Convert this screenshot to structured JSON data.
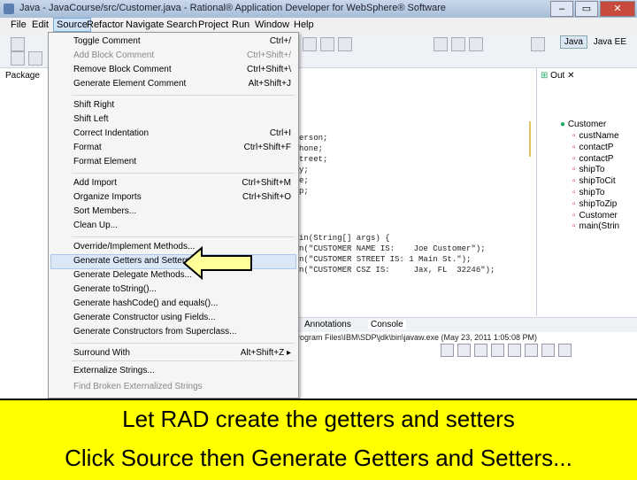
{
  "window": {
    "title": "Java - JavaCourse/src/Customer.java - Rational® Application Developer for WebSphere® Software"
  },
  "menubar": [
    "File",
    "Edit",
    "Source",
    "Refactor",
    "Navigate",
    "Search",
    "Project",
    "Run",
    "Window",
    "Help"
  ],
  "perspective": {
    "java": "Java",
    "java_ee": "Java EE"
  },
  "left_tab": "Package",
  "source_menu": [
    {
      "label": "Toggle Comment",
      "shortcut": "Ctrl+/",
      "disabled": false
    },
    {
      "label": "Add Block Comment",
      "shortcut": "Ctrl+Shift+/",
      "disabled": true
    },
    {
      "label": "Remove Block Comment",
      "shortcut": "Ctrl+Shift+\\",
      "disabled": false
    },
    {
      "label": "Generate Element Comment",
      "shortcut": "Alt+Shift+J",
      "disabled": false
    },
    {
      "label": "Shift Right",
      "shortcut": "",
      "disabled": false
    },
    {
      "label": "Shift Left",
      "shortcut": "",
      "disabled": false
    },
    {
      "label": "Correct Indentation",
      "shortcut": "Ctrl+I",
      "disabled": false
    },
    {
      "label": "Format",
      "shortcut": "Ctrl+Shift+F",
      "disabled": false
    },
    {
      "label": "Format Element",
      "shortcut": "",
      "disabled": false
    },
    {
      "label": "Add Import",
      "shortcut": "Ctrl+Shift+M",
      "disabled": false
    },
    {
      "label": "Organize Imports",
      "shortcut": "Ctrl+Shift+O",
      "disabled": false
    },
    {
      "label": "Sort Members...",
      "shortcut": "",
      "disabled": false
    },
    {
      "label": "Clean Up...",
      "shortcut": "",
      "disabled": false
    },
    {
      "label": "Override/Implement Methods...",
      "shortcut": "",
      "disabled": false
    },
    {
      "label": "Generate Getters and Setters...",
      "shortcut": "",
      "disabled": false
    },
    {
      "label": "Generate Delegate Methods...",
      "shortcut": "",
      "disabled": false
    },
    {
      "label": "Generate toString()...",
      "shortcut": "",
      "disabled": false
    },
    {
      "label": "Generate hashCode() and equals()...",
      "shortcut": "",
      "disabled": false
    },
    {
      "label": "Generate Constructor using Fields...",
      "shortcut": "",
      "disabled": false
    },
    {
      "label": "Generate Constructors from Superclass...",
      "shortcut": "",
      "disabled": false
    },
    {
      "label": "Surround With",
      "shortcut": "Alt+Shift+Z ▸",
      "disabled": false
    },
    {
      "label": "Externalize Strings...",
      "shortcut": "",
      "disabled": false
    },
    {
      "label": "Find Broken Externalized Strings",
      "shortcut": "",
      "disabled": true
    }
  ],
  "code_lines": [
    "erson;",
    "hone;",
    "treet;",
    "y;",
    "e;",
    "p;",
    "in(String[] args) {",
    "n(\"CUSTOMER NAME IS:    Joe Customer\");",
    "n(\"CUSTOMER STREET IS: 1 Main St.\");",
    "n(\"CUSTOMER CSZ IS:     Jax, FL  32246\");"
  ],
  "outline": {
    "tab": "Out",
    "root": "Customer",
    "items": [
      "custName",
      "contactP",
      "contactP",
      "shipTo",
      "shipToCit",
      "shipTo",
      "shipToZip",
      "Customer",
      "main(Strin"
    ]
  },
  "bottom_tabs": {
    "annotations": "Annotations",
    "console": "Console"
  },
  "console_line": "rogram Files\\IBM\\SDP\\jdk\\bin\\javaw.exe (May 23, 2011 1:05:08 PM)",
  "caption": {
    "line1": "Let RAD create the getters and setters",
    "line2": "Click Source then Generate Getters and Setters..."
  },
  "colors": {
    "caption_bg": "#ffff00",
    "arrow_fill": "#ffff99",
    "menu_highlight": "#d9e7f7"
  }
}
